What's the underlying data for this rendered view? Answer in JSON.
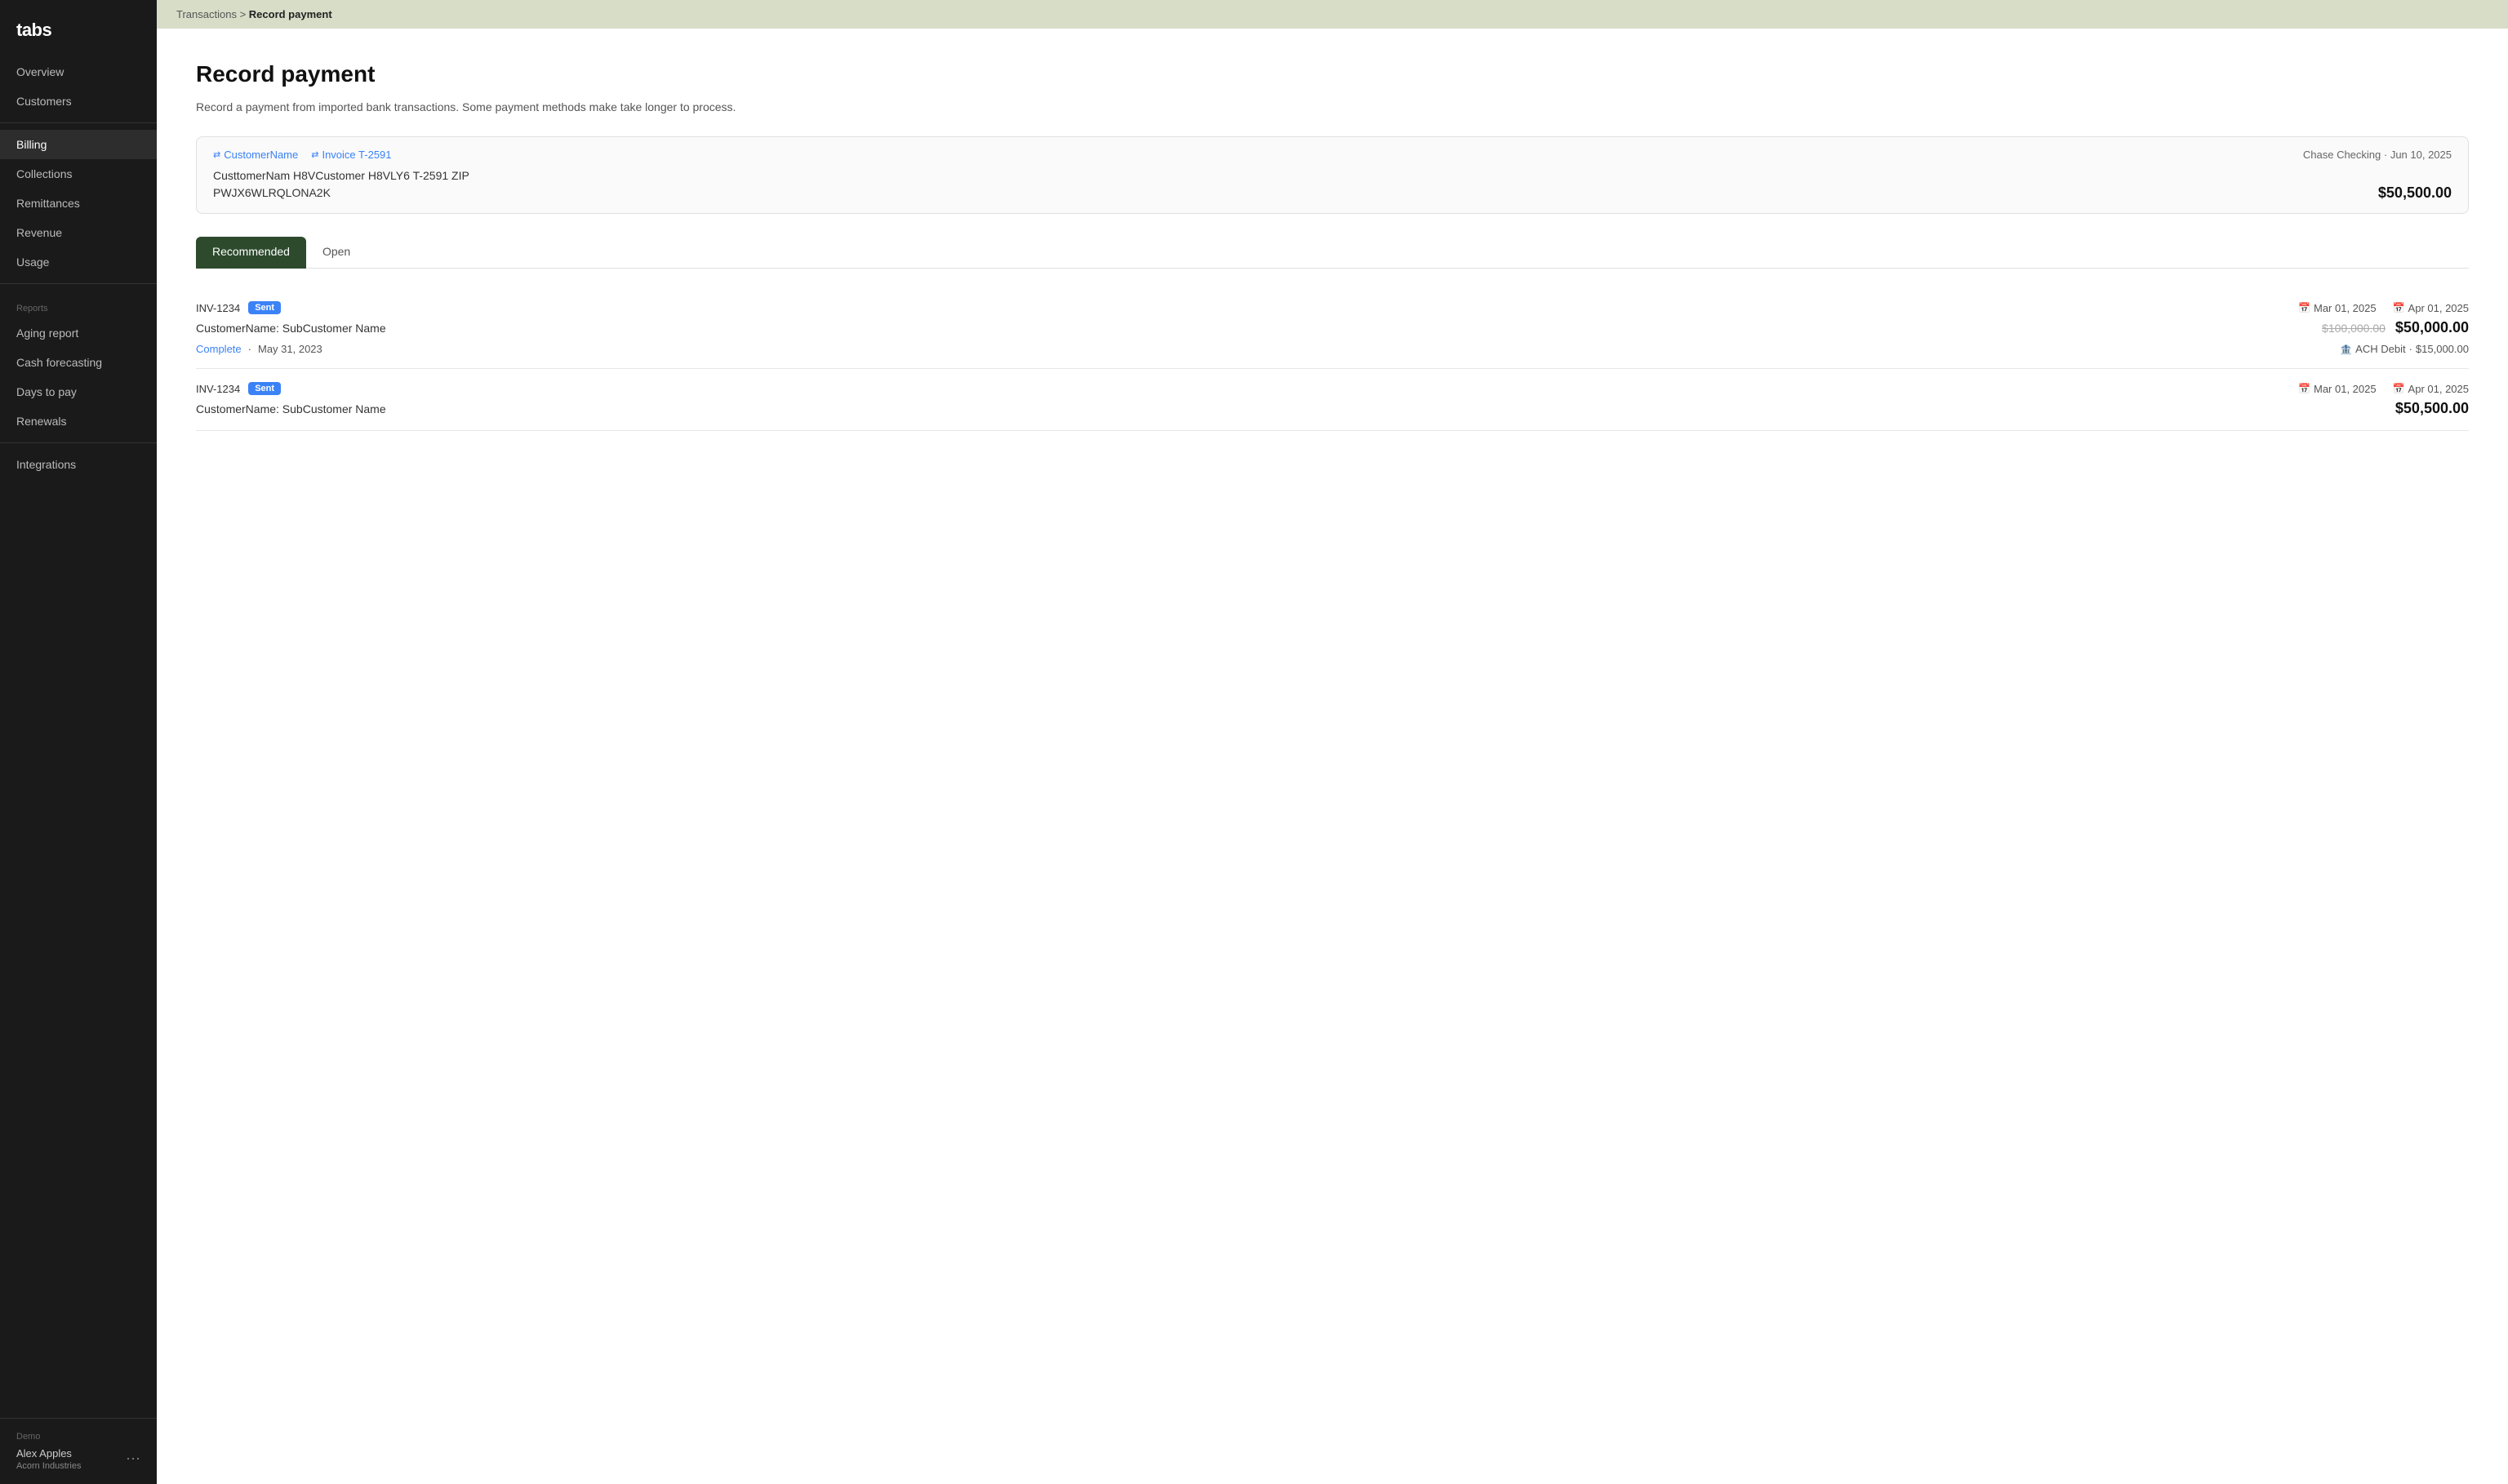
{
  "sidebar": {
    "logo": "tabs",
    "items": [
      {
        "id": "overview",
        "label": "Overview",
        "active": false
      },
      {
        "id": "customers",
        "label": "Customers",
        "active": false
      },
      {
        "id": "billing",
        "label": "Billing",
        "active": true
      },
      {
        "id": "collections",
        "label": "Collections",
        "active": false
      },
      {
        "id": "remittances",
        "label": "Remittances",
        "active": false
      },
      {
        "id": "revenue",
        "label": "Revenue",
        "active": false
      },
      {
        "id": "usage",
        "label": "Usage",
        "active": false
      }
    ],
    "reports_label": "Reports",
    "reports_items": [
      {
        "id": "aging-report",
        "label": "Aging report"
      },
      {
        "id": "cash-forecasting",
        "label": "Cash forecasting"
      },
      {
        "id": "days-to-pay",
        "label": "Days to pay"
      },
      {
        "id": "renewals",
        "label": "Renewals"
      }
    ],
    "integrations_label": "Integrations",
    "footer": {
      "demo_label": "Demo",
      "user_name": "Alex Apples",
      "company": "Acorn Industries",
      "dots": "···"
    }
  },
  "breadcrumb": {
    "parent": "Transactions",
    "separator": ">",
    "current": "Record payment"
  },
  "page": {
    "title": "Record payment",
    "description": "Record a payment from imported bank transactions. Some payment methods make take longer to process."
  },
  "transaction_card": {
    "customer_name_label": "CustomerName",
    "invoice_label": "Invoice T-2591",
    "meta": "Chase Checking  ·  Jun 10, 2025",
    "description_line1": "CusttomerNam H8VCustomer H8VLY6 T-2591 ZIP",
    "description_line2": "PWJX6WLRQLONA2K",
    "amount": "$50,500.00"
  },
  "tabs": {
    "recommended": "Recommended",
    "open": "Open"
  },
  "invoices": [
    {
      "id": "INV-1234",
      "badge": "Sent",
      "issue_date": "Mar 01, 2025",
      "due_date": "Apr 01, 2025",
      "customer": "CustomerName: SubCustomer Name",
      "amount_original": "$100,000.00",
      "amount_current": "$50,000.00",
      "sub_status": "Complete",
      "sub_date": "May 31, 2023",
      "sub_payment": "ACH Debit",
      "sub_amount": "$15,000.00"
    },
    {
      "id": "INV-1234",
      "badge": "Sent",
      "issue_date": "Mar 01, 2025",
      "due_date": "Apr 01, 2025",
      "customer": "CustomerName: SubCustomer Name",
      "amount_original": null,
      "amount_current": "$50,500.00",
      "sub_status": null,
      "sub_date": null,
      "sub_payment": null,
      "sub_amount": null
    }
  ]
}
